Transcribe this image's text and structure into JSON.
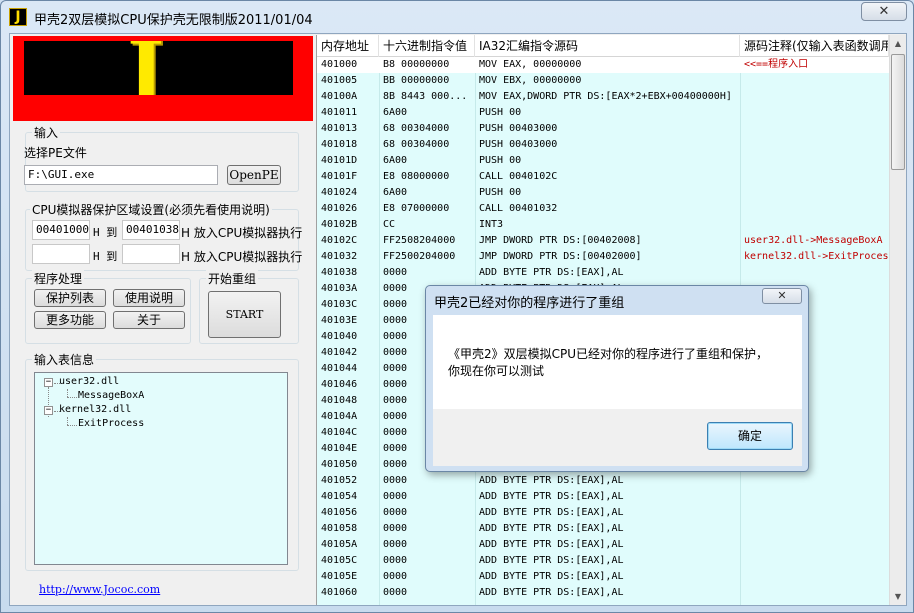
{
  "window": {
    "title": "甲壳2双层模拟CPU保护壳无限制版2011/01/04",
    "icon_letter": "J",
    "close_glyph": "✕"
  },
  "logo": {
    "letter": "J"
  },
  "input_group": {
    "title": "输入",
    "select_pe_label": "选择PE文件",
    "path_value": "F:\\GUI.exe",
    "open_button": "OpenPE"
  },
  "cpu_region": {
    "title": "CPU模拟器保护区域设置(必须先看使用说明)",
    "row1": {
      "start": "00401000",
      "h1": "H 到",
      "end": "00401038",
      "h2": "H 放入CPU模拟器执行"
    },
    "row2": {
      "start": "",
      "h1": "H 到",
      "end": "",
      "h2": "H 放入CPU模拟器执行"
    }
  },
  "processing": {
    "title": "程序处理",
    "protect_list": "保护列表",
    "usage": "使用说明",
    "more": "更多功能",
    "about": "关于"
  },
  "restructure": {
    "title": "开始重组",
    "start_button": "START"
  },
  "import_info": {
    "title": "输入表信息",
    "tree": [
      {
        "dll": "user32.dll",
        "func": "MessageBoxA"
      },
      {
        "dll": "kernel32.dll",
        "func": "ExitProcess"
      }
    ]
  },
  "footer_link": "http://www.Jococ.com",
  "grid": {
    "headers": [
      "内存地址",
      "十六进制指令值",
      "IA32汇编指令源码",
      "源码注释(仅输入表函数调用"
    ],
    "rows": [
      [
        "401000",
        "B8 00000000",
        "MOV EAX, 00000000",
        "<<==程序入口"
      ],
      [
        "401005",
        "BB 00000000",
        "MOV EBX, 00000000",
        ""
      ],
      [
        "40100A",
        "8B 8443 000...",
        "MOV EAX,DWORD PTR DS:[EAX*2+EBX+00400000H]",
        ""
      ],
      [
        "401011",
        "6A00",
        "PUSH 00",
        ""
      ],
      [
        "401013",
        "68 00304000",
        "PUSH 00403000",
        ""
      ],
      [
        "401018",
        "68 00304000",
        "PUSH 00403000",
        ""
      ],
      [
        "40101D",
        "6A00",
        "PUSH 00",
        ""
      ],
      [
        "40101F",
        "E8 08000000",
        "CALL 0040102C",
        ""
      ],
      [
        "401024",
        "6A00",
        "PUSH 00",
        ""
      ],
      [
        "401026",
        "E8 07000000",
        "CALL 00401032",
        ""
      ],
      [
        "40102B",
        "CC",
        "INT3",
        ""
      ],
      [
        "40102C",
        "FF2508204000",
        "JMP DWORD PTR DS:[00402008]",
        "user32.dll->MessageBoxA"
      ],
      [
        "401032",
        "FF2500204000",
        "JMP DWORD PTR DS:[00402000]",
        "kernel32.dll->ExitProcess"
      ],
      [
        "401038",
        "0000",
        "ADD BYTE PTR DS:[EAX],AL",
        ""
      ],
      [
        "40103A",
        "0000",
        "ADD BYTE PTR DS:[EAX],AL",
        ""
      ],
      [
        "40103C",
        "0000",
        "ADD BYTE PTR DS:[EAX],AL",
        ""
      ],
      [
        "40103E",
        "0000",
        "ADD BYTE PTR DS:[EAX],AL",
        ""
      ],
      [
        "401040",
        "0000",
        "ADD BYTE PTR DS:[EAX],AL",
        ""
      ],
      [
        "401042",
        "0000",
        "ADD BYTE PTR DS:[EAX],AL",
        ""
      ],
      [
        "401044",
        "0000",
        "ADD BYTE PTR DS:[EAX],AL",
        ""
      ],
      [
        "401046",
        "0000",
        "ADD BYTE PTR DS:[EAX],AL",
        ""
      ],
      [
        "401048",
        "0000",
        "ADD BYTE PTR DS:[EAX],AL",
        ""
      ],
      [
        "40104A",
        "0000",
        "ADD BYTE PTR DS:[EAX],AL",
        ""
      ],
      [
        "40104C",
        "0000",
        "ADD BYTE PTR DS:[EAX],AL",
        ""
      ],
      [
        "40104E",
        "0000",
        "ADD BYTE PTR DS:[EAX],AL",
        ""
      ],
      [
        "401050",
        "0000",
        "ADD BYTE PTR DS:[EAX],AL",
        ""
      ],
      [
        "401052",
        "0000",
        "ADD BYTE PTR DS:[EAX],AL",
        ""
      ],
      [
        "401054",
        "0000",
        "ADD BYTE PTR DS:[EAX],AL",
        ""
      ],
      [
        "401056",
        "0000",
        "ADD BYTE PTR DS:[EAX],AL",
        ""
      ],
      [
        "401058",
        "0000",
        "ADD BYTE PTR DS:[EAX],AL",
        ""
      ],
      [
        "40105A",
        "0000",
        "ADD BYTE PTR DS:[EAX],AL",
        ""
      ],
      [
        "40105C",
        "0000",
        "ADD BYTE PTR DS:[EAX],AL",
        ""
      ],
      [
        "40105E",
        "0000",
        "ADD BYTE PTR DS:[EAX],AL",
        ""
      ],
      [
        "401060",
        "0000",
        "ADD BYTE PTR DS:[EAX],AL",
        ""
      ]
    ]
  },
  "dialog": {
    "title": "甲壳2已经对你的程序进行了重组",
    "close_glyph": "✕",
    "line1": "《甲壳2》双层模拟CPU已经对你的程序进行了重组和保护，",
    "line2": "你现在你可以测试",
    "ok": "确定"
  },
  "scrollbar": {
    "up": "▲",
    "down": "▼"
  },
  "colors": {
    "grid_bg": "#e0fcfc",
    "comment_red": "#c00000",
    "logo_red": "#ff0000",
    "logo_yellow": "#ffea00"
  }
}
